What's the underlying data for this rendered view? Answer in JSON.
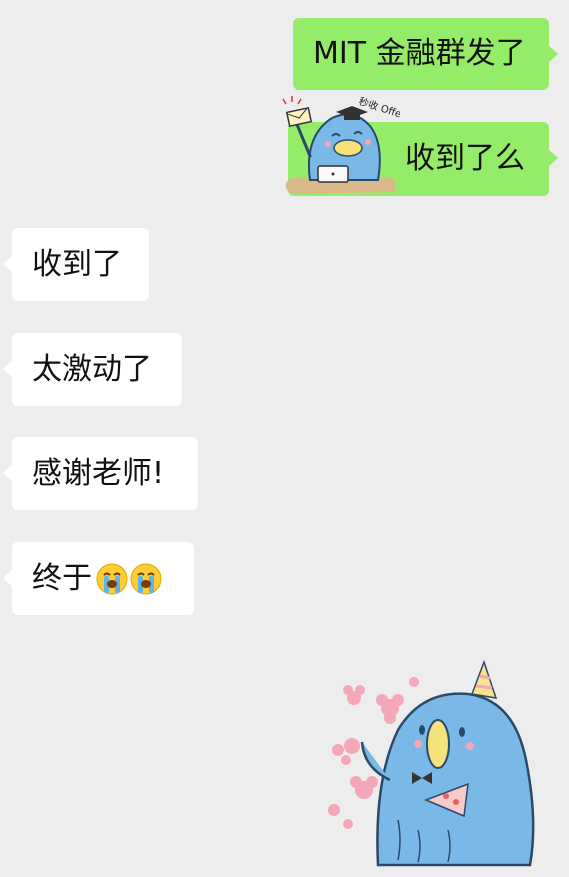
{
  "messages": [
    {
      "side": "out",
      "text": "MIT 金融群发了"
    },
    {
      "side": "out",
      "text": "收到了么"
    },
    {
      "side": "in",
      "text": "收到了"
    },
    {
      "side": "in",
      "text": "太激动了"
    },
    {
      "side": "in",
      "text": "感谢老师!"
    },
    {
      "side": "in",
      "text": "终于",
      "emojis": [
        "loudly-crying-face",
        "loudly-crying-face"
      ]
    }
  ],
  "stickers": {
    "offer_sticker": {
      "caption": "秒收 Offer",
      "icon": "penguin-graduate-laptop-sticker"
    },
    "party_sticker": {
      "icon": "penguin-party-hat-cake-sticker"
    }
  },
  "colors": {
    "background": "#ededed",
    "outgoing_bubble": "#95ec69",
    "incoming_bubble": "#ffffff",
    "sticker_blue": "#7ab8e8"
  }
}
